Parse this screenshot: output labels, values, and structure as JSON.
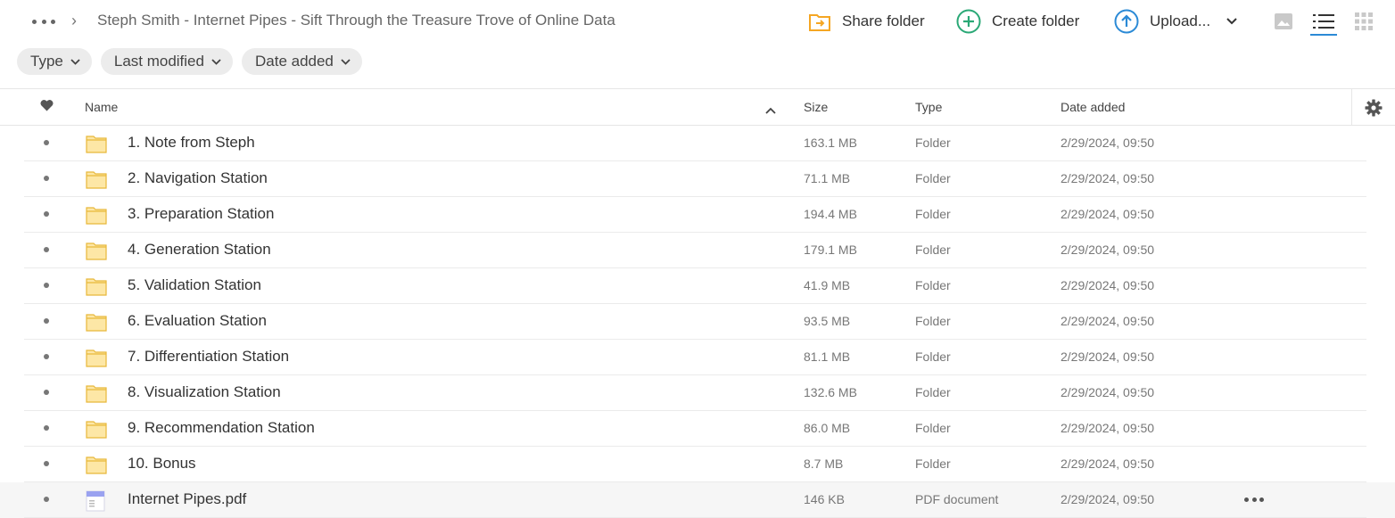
{
  "breadcrumb": {
    "separator": "›",
    "title": "Steph Smith - Internet Pipes - Sift Through the Treasure Trove of Online Data"
  },
  "toolbar": {
    "share_label": "Share folder",
    "create_label": "Create folder",
    "upload_label": "Upload...",
    "accent_color": "#2b8ad6",
    "share_icon_color": "#f5a623",
    "create_icon_color": "#2aa876",
    "upload_icon_color": "#2b8ad6"
  },
  "filters": [
    {
      "label": "Type"
    },
    {
      "label": "Last modified"
    },
    {
      "label": "Date added"
    }
  ],
  "table": {
    "headers": {
      "name": "Name",
      "size": "Size",
      "type": "Type",
      "date": "Date added"
    },
    "rows": [
      {
        "name": "1. Note from Steph",
        "size": "163.1 MB",
        "type": "Folder",
        "date": "2/29/2024, 09:50",
        "icon": "folder-icon"
      },
      {
        "name": "2. Navigation Station",
        "size": "71.1 MB",
        "type": "Folder",
        "date": "2/29/2024, 09:50",
        "icon": "folder-icon"
      },
      {
        "name": "3. Preparation Station",
        "size": "194.4 MB",
        "type": "Folder",
        "date": "2/29/2024, 09:50",
        "icon": "folder-icon"
      },
      {
        "name": "4. Generation Station",
        "size": "179.1 MB",
        "type": "Folder",
        "date": "2/29/2024, 09:50",
        "icon": "folder-icon"
      },
      {
        "name": "5. Validation Station",
        "size": "41.9 MB",
        "type": "Folder",
        "date": "2/29/2024, 09:50",
        "icon": "folder-icon"
      },
      {
        "name": "6. Evaluation Station",
        "size": "93.5 MB",
        "type": "Folder",
        "date": "2/29/2024, 09:50",
        "icon": "folder-icon"
      },
      {
        "name": "7. Differentiation Station",
        "size": "81.1 MB",
        "type": "Folder",
        "date": "2/29/2024, 09:50",
        "icon": "folder-icon"
      },
      {
        "name": "8. Visualization Station",
        "size": "132.6 MB",
        "type": "Folder",
        "date": "2/29/2024, 09:50",
        "icon": "folder-icon"
      },
      {
        "name": "9. Recommendation Station",
        "size": "86.0 MB",
        "type": "Folder",
        "date": "2/29/2024, 09:50",
        "icon": "folder-icon"
      },
      {
        "name": "10. Bonus",
        "size": "8.7 MB",
        "type": "Folder",
        "date": "2/29/2024, 09:50",
        "icon": "folder-icon"
      },
      {
        "name": "Internet Pipes.pdf",
        "size": "146 KB",
        "type": "PDF document",
        "date": "2/29/2024, 09:50",
        "icon": "pdf-file-icon",
        "hovered": true
      }
    ]
  }
}
